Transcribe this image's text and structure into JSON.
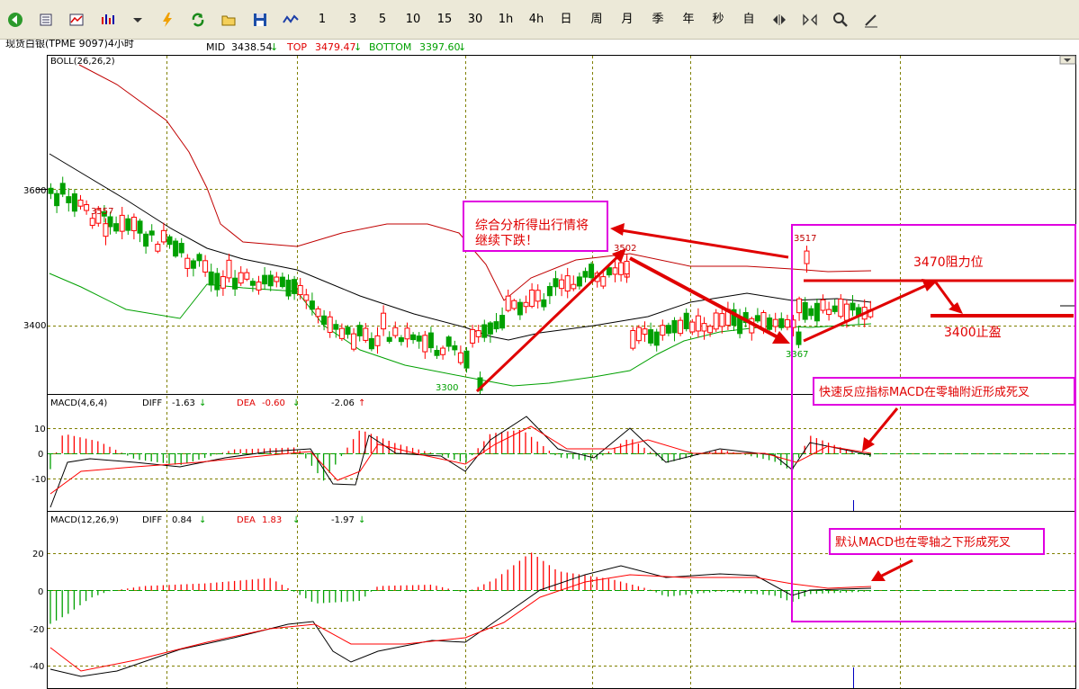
{
  "toolbar": {
    "icons": [
      "back-icon",
      "kline-list-icon",
      "line-chart-icon",
      "indicator-icon",
      "dropdown-icon",
      "lightning-icon",
      "refresh-icon",
      "open-folder-icon",
      "save-icon",
      "wave-icon"
    ],
    "periods": [
      "1",
      "3",
      "5",
      "10",
      "15",
      "30",
      "1h",
      "4h",
      "日",
      "周",
      "月",
      "季",
      "年",
      "秒",
      "自"
    ],
    "tools": [
      "shrink-icon",
      "expand-icon",
      "zoom-icon",
      "draw-pen-icon"
    ]
  },
  "header": {
    "symbol": "现货白银(TPME 9097)4小时",
    "mid_label": "MID",
    "mid_value": "3438.54",
    "top_label": "TOP",
    "top_value": "3479.47",
    "bottom_label": "BOTTOM",
    "bottom_value": "3397.60",
    "arrow_down": "↓",
    "arrow_up": "↑"
  },
  "panels": {
    "boll": {
      "label": "BOLL(26,26,2)",
      "y_ticks": [
        "3600",
        "3400"
      ],
      "price_labels": {
        "p3557": "3557",
        "p3502": "3502",
        "p3517": "3517",
        "p3300": "3300",
        "p3367": "3367"
      }
    },
    "macd1": {
      "label": "MACD(4,6,4)",
      "diff_label": "DIFF",
      "diff_value": "-1.63",
      "dea_label": "DEA",
      "dea_value": "-0.60",
      "macd_value": "-2.06",
      "y_ticks": [
        "10",
        "0",
        "-10"
      ]
    },
    "macd2": {
      "label": "MACD(12,26,9)",
      "diff_label": "DIFF",
      "diff_value": "0.84",
      "dea_label": "DEA",
      "dea_value": "1.83",
      "macd_value": "-1.97",
      "y_ticks": [
        "20",
        "0",
        "-20",
        "-40"
      ]
    }
  },
  "annotations": {
    "analysis_line1": "综合分析得出行情将",
    "analysis_line2": "继续下跌！",
    "resistance": "3470阻力位",
    "take_profit": "3400止盈",
    "macd_fast": "快速反应指标MACD在零轴附近形成死叉",
    "macd_default": "默认MACD也在零轴之下形成死叉"
  },
  "colors": {
    "up": "#FF0000",
    "down": "#00A000",
    "boll_upper": "#C00000",
    "boll_lower": "#00A000",
    "mid": "#000000",
    "grid": "#808000",
    "annotation_border": "#E000E0",
    "annotation_text": "#E00000"
  },
  "chart_data": [
    {
      "type": "candlestick",
      "title": "BOLL(26,26,2)",
      "ylim": [
        3290,
        3700
      ],
      "y_ticks": [
        3400,
        3600
      ],
      "marked_prices": [
        3557,
        3502,
        3517,
        3300,
        3367
      ],
      "series": [
        {
          "name": "MID",
          "last": 3438.54
        },
        {
          "name": "TOP",
          "last": 3479.47
        },
        {
          "name": "BOTTOM",
          "last": 3397.6
        }
      ]
    },
    {
      "type": "bar",
      "title": "MACD(4,6,4)",
      "ylim": [
        -20,
        17
      ],
      "series": [
        {
          "name": "DIFF",
          "last": -1.63
        },
        {
          "name": "DEA",
          "last": -0.6
        }
      ]
    },
    {
      "type": "bar",
      "title": "MACD(12,26,9)",
      "ylim": [
        -48,
        30
      ],
      "series": [
        {
          "name": "DIFF",
          "last": 0.84
        },
        {
          "name": "DEA",
          "last": 1.83
        }
      ]
    }
  ]
}
